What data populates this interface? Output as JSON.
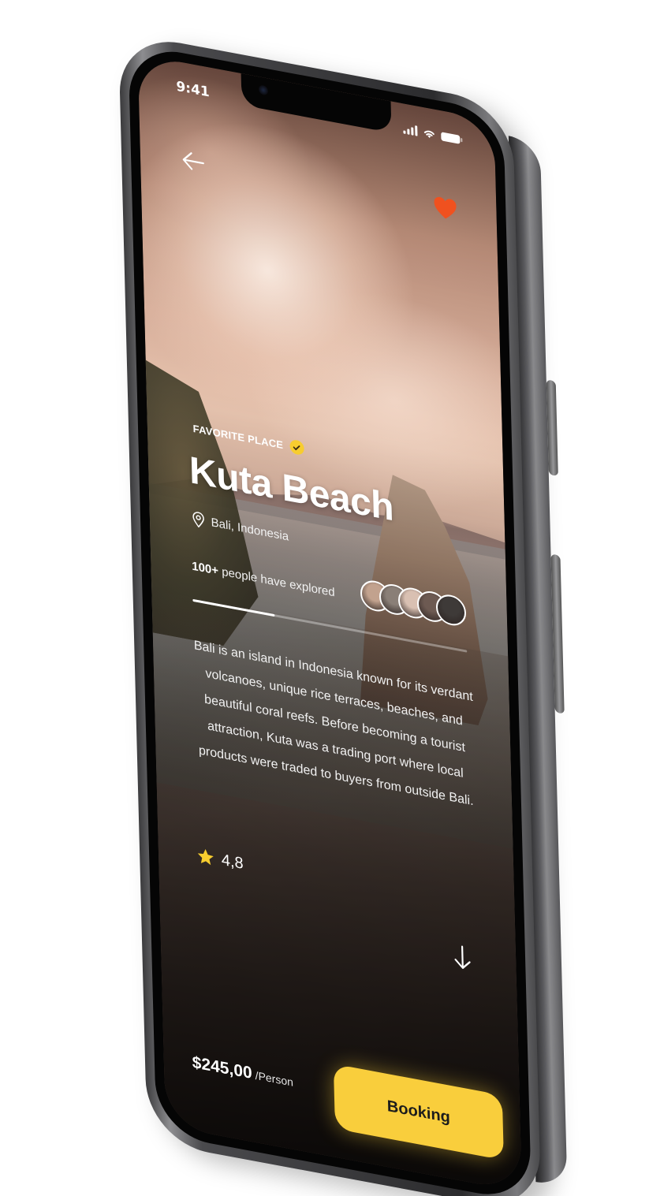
{
  "status_bar": {
    "time": "9:41"
  },
  "header": {
    "back_icon": "arrow-left-icon",
    "favorite_icon": "heart-icon",
    "favorite_color": "#f0511f"
  },
  "place": {
    "tag": "FAVORITE PLACE",
    "verified_icon": "check-badge-icon",
    "name": "Kuta Beach",
    "location_icon": "map-pin-icon",
    "location": "Bali, Indonesia",
    "explored_count": "100+",
    "explored_text": " people have explored",
    "visitor_avatars": [
      "#c2a28e",
      "#8a7f77",
      "#d9c0b2",
      "#6d5a52",
      "#3e3a38"
    ],
    "progress_fraction": 0.3,
    "description": "Bali is an island in Indonesia known for its verdant volcanoes, unique rice terraces, beaches, and beautiful coral reefs. Before becoming a tourist attraction, Kuta was a trading port where local products were traded to buyers from outside Bali.",
    "rating": "4,8",
    "rating_icon": "star-icon",
    "rating_color": "#f7cd2f",
    "scroll_icon": "arrow-down-icon"
  },
  "footer": {
    "price": "$245,00",
    "price_unit": "/Person",
    "booking_label": "Booking",
    "booking_color": "#f9ce3c"
  }
}
